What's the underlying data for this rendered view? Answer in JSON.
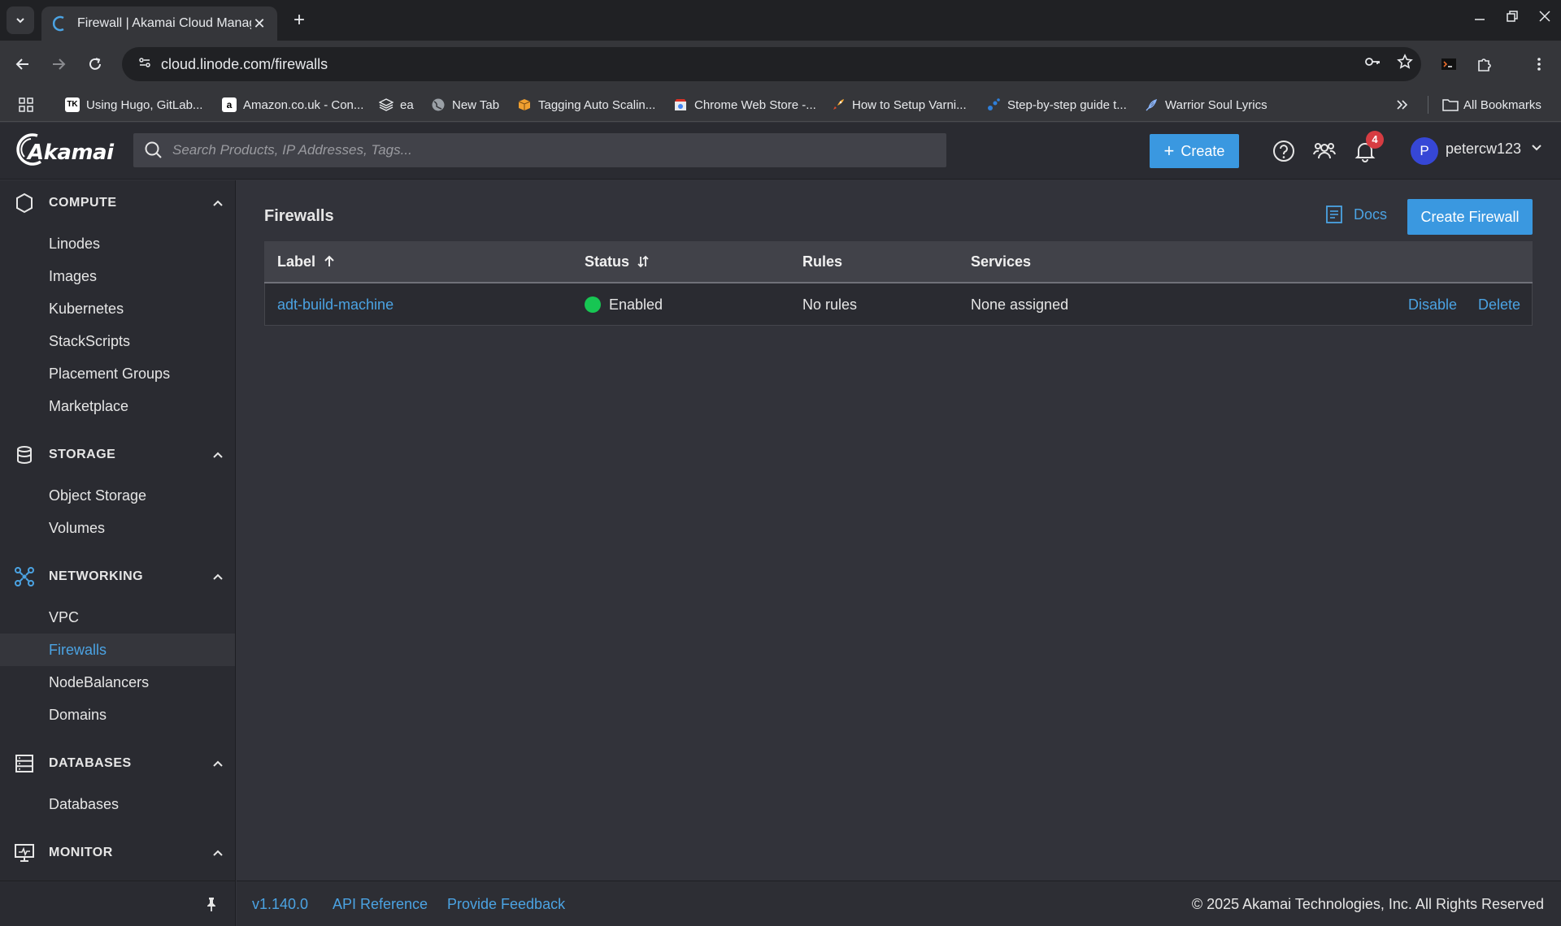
{
  "browser": {
    "tab_title": "Firewall | Akamai Cloud Manag",
    "url": "cloud.linode.com/firewalls",
    "bookmarks": [
      {
        "label": "Using Hugo, GitLab...",
        "icon": "TK"
      },
      {
        "label": "Amazon.co.uk - Con...",
        "icon": "a"
      },
      {
        "label": "ea",
        "icon": "layers"
      },
      {
        "label": "New Tab",
        "icon": "globe"
      },
      {
        "label": "Tagging Auto Scalin...",
        "icon": "box"
      },
      {
        "label": "Chrome Web Store -...",
        "icon": "store"
      },
      {
        "label": "How to Setup Varni...",
        "icon": "rocket"
      },
      {
        "label": "Step-by-step guide t...",
        "icon": "dots"
      },
      {
        "label": "Warrior Soul Lyrics",
        "icon": "feather"
      }
    ],
    "all_bookmarks": "All Bookmarks"
  },
  "header": {
    "logo": "Akamai",
    "search_placeholder": "Search Products, IP Addresses, Tags...",
    "create_label": "Create",
    "notification_count": "4",
    "avatar_initial": "P",
    "username": "petercw123"
  },
  "sidebar": {
    "sections": [
      {
        "title": "COMPUTE",
        "items": [
          "Linodes",
          "Images",
          "Kubernetes",
          "StackScripts",
          "Placement Groups",
          "Marketplace"
        ]
      },
      {
        "title": "STORAGE",
        "items": [
          "Object Storage",
          "Volumes"
        ]
      },
      {
        "title": "NETWORKING",
        "items": [
          "VPC",
          "Firewalls",
          "NodeBalancers",
          "Domains"
        ]
      },
      {
        "title": "DATABASES",
        "items": [
          "Databases"
        ]
      },
      {
        "title": "MONITOR",
        "items": []
      }
    ],
    "active_item": "Firewalls"
  },
  "main": {
    "title": "Firewalls",
    "docs_label": "Docs",
    "create_firewall_label": "Create Firewall",
    "table": {
      "columns": [
        "Label",
        "Status",
        "Rules",
        "Services"
      ],
      "rows": [
        {
          "label": "adt-build-machine",
          "status": "Enabled",
          "rules": "No rules",
          "services": "None assigned",
          "actions": [
            "Disable",
            "Delete"
          ]
        }
      ]
    }
  },
  "footer": {
    "version": "v1.140.0",
    "api_reference": "API Reference",
    "provide_feedback": "Provide Feedback",
    "copyright": "© 2025 Akamai Technologies, Inc. All Rights Reserved"
  },
  "colors": {
    "accent": "#3a98e0",
    "link": "#4ba3e3",
    "status_enabled": "#17c653",
    "badge": "#d63c42"
  }
}
